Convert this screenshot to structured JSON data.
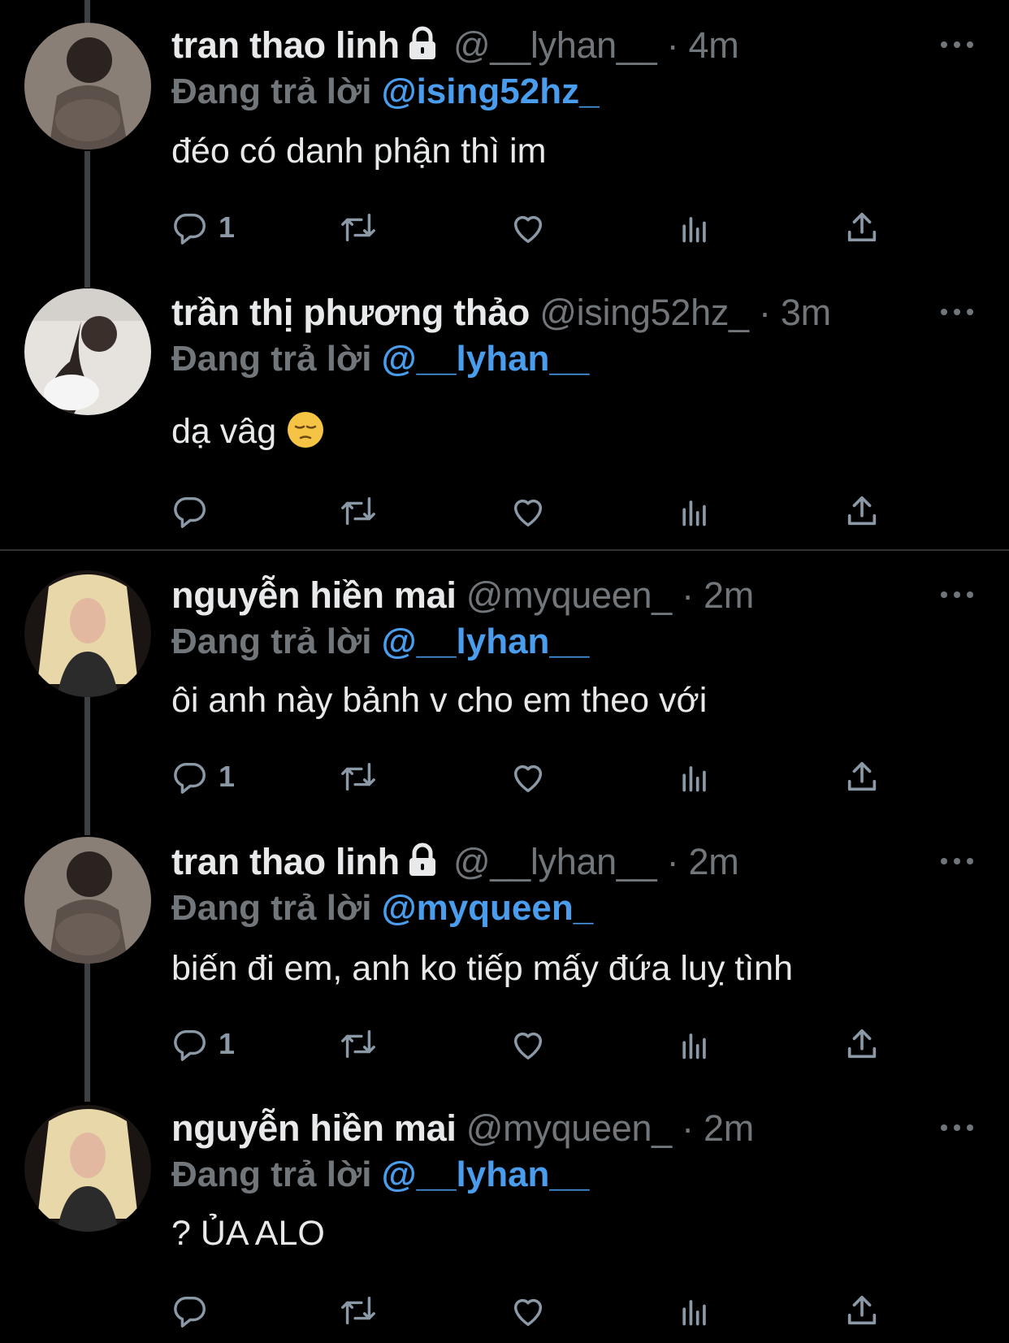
{
  "replying_label": "Đang trả lời",
  "tweets": [
    {
      "name": "tran thao linh",
      "locked": true,
      "handle": "@__lyhan__",
      "dot": "·",
      "time": "4m",
      "reply_to": "@ising52hz_",
      "text": "đéo có danh phận thì im",
      "reply_count": "1"
    },
    {
      "name": "trần thị phương thảo",
      "locked": false,
      "handle": "@ising52hz_",
      "dot": "·",
      "time": "3m",
      "reply_to": "@__lyhan__",
      "text": "dạ vâg",
      "emoji": "pensive-face",
      "reply_count": ""
    },
    {
      "name": "nguyễn hiền mai",
      "locked": false,
      "handle": "@myqueen_",
      "dot": "·",
      "time": "2m",
      "reply_to": "@__lyhan__",
      "text": "ôi anh này bảnh v cho em theo với",
      "reply_count": "1"
    },
    {
      "name": "tran thao linh",
      "locked": true,
      "handle": "@__lyhan__",
      "dot": "·",
      "time": "2m",
      "reply_to": "@myqueen_",
      "text": "biến đi em, anh ko tiếp mấy đứa luỵ tình",
      "reply_count": "1"
    },
    {
      "name": "nguyễn hiền mai",
      "locked": false,
      "handle": "@myqueen_",
      "dot": "·",
      "time": "2m",
      "reply_to": "@__lyhan__",
      "text": "? ỦA ALO",
      "reply_count": ""
    }
  ]
}
